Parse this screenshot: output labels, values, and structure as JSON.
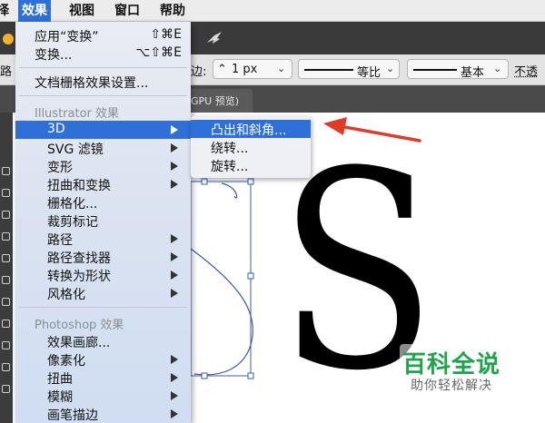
{
  "menubar": {
    "items": [
      "择",
      "效果",
      "视图",
      "窗口",
      "帮助"
    ],
    "active_index": 1
  },
  "control_bar": {
    "stroke_label": "边:",
    "stroke_value": "1 px",
    "profile_label": "等比",
    "brush_label": "基本",
    "opacity_label": "不透"
  },
  "doc_tab": {
    "label": "GPU 预览)"
  },
  "effect_menu": {
    "apply_label": "应用“变换”",
    "apply_shortcut": "⇧⌘E",
    "transform_label": "变换...",
    "transform_shortcut": "⌥⇧⌘E",
    "raster_settings_label": "文档栅格效果设置...",
    "illustrator_section": "Illustrator 效果",
    "illustrator_items": [
      "3D",
      "SVG 滤镜",
      "变形",
      "扭曲和变换",
      "栅格化...",
      "裁剪标记",
      "路径",
      "路径查找器",
      "转换为形状",
      "风格化"
    ],
    "photoshop_section": "Photoshop 效果",
    "photoshop_items": [
      "效果画廊...",
      "像素化",
      "扭曲",
      "模糊",
      "画笔描边"
    ]
  },
  "submenu_3d": {
    "items": [
      "凸出和斜角...",
      "绕转...",
      "旋转..."
    ],
    "highlighted_index": 0
  },
  "artboard": {
    "letter": "S"
  },
  "watermark": {
    "title": "百科全说",
    "subtitle": "助你轻松解决"
  },
  "colors": {
    "highlight": "#2f6fd8",
    "annotation_arrow": "#e03a2a",
    "watermark_green": "#1ea54c",
    "anchor_outline": "#3c5ba8"
  },
  "icons": [
    "traffic-light-icon",
    "bird-icon",
    "chevron-down-icon",
    "submenu-arrow-icon",
    "annotation-arrow-icon"
  ]
}
